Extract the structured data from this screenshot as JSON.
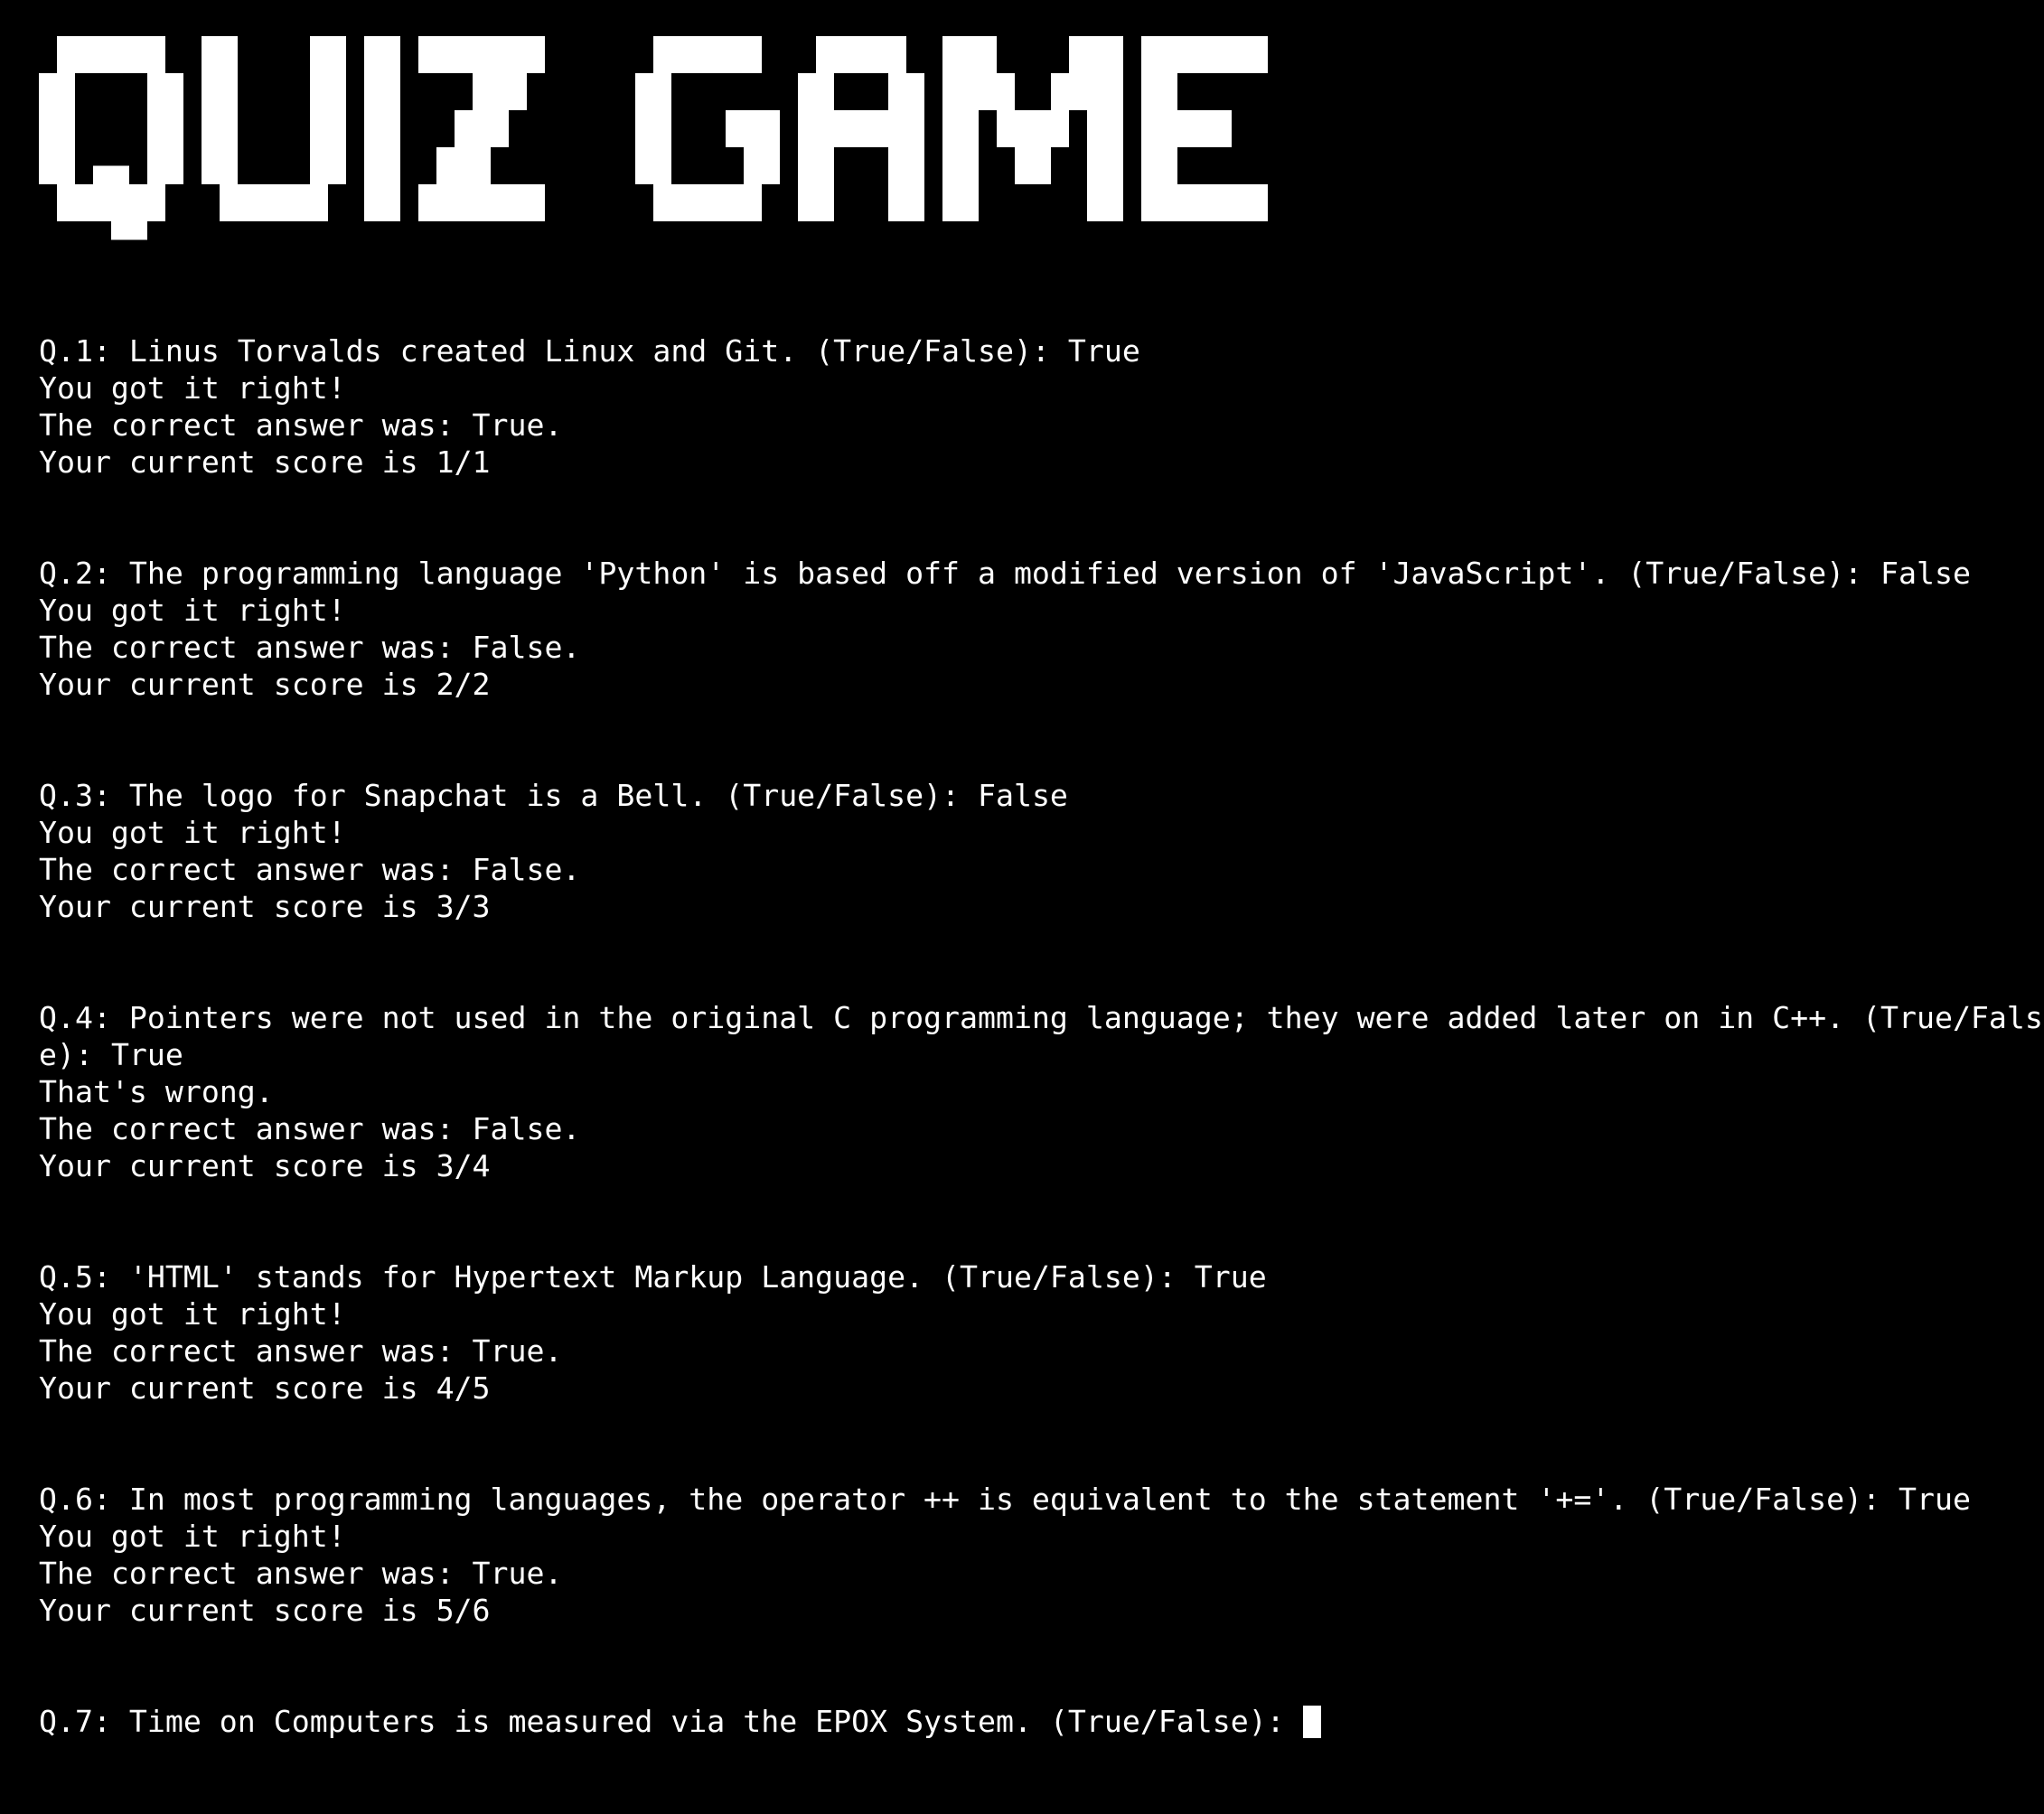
{
  "title": "QUIZ GAME",
  "colors": {
    "background": "#000000",
    "text": "#ffffff"
  },
  "questions": [
    {
      "prompt": "Q.1: Linus Torvalds created Linux and Git. (True/False): ",
      "user_answer": "True",
      "feedback": "You got it right!",
      "correct_line": "The correct answer was: True.",
      "score_line": "Your current score is 1/1"
    },
    {
      "prompt": "Q.2: The programming language 'Python' is based off a modified version of 'JavaScript'. (True/False): ",
      "user_answer": "False",
      "feedback": "You got it right!",
      "correct_line": "The correct answer was: False.",
      "score_line": "Your current score is 2/2"
    },
    {
      "prompt": "Q.3: The logo for Snapchat is a Bell. (True/False): ",
      "user_answer": "False",
      "feedback": "You got it right!",
      "correct_line": "The correct answer was: False.",
      "score_line": "Your current score is 3/3"
    },
    {
      "prompt": "Q.4: Pointers were not used in the original C programming language; they were added later on in C++. (True/False): ",
      "user_answer": "True",
      "feedback": "That's wrong.",
      "correct_line": "The correct answer was: False.",
      "score_line": "Your current score is 3/4"
    },
    {
      "prompt": "Q.5: 'HTML' stands for Hypertext Markup Language. (True/False): ",
      "user_answer": "True",
      "feedback": "You got it right!",
      "correct_line": "The correct answer was: True.",
      "score_line": "Your current score is 4/5"
    },
    {
      "prompt": "Q.6: In most programming languages, the operator ++ is equivalent to the statement '+='. (True/False): ",
      "user_answer": "True",
      "feedback": "You got it right!",
      "correct_line": "The correct answer was: True.",
      "score_line": "Your current score is 5/6"
    }
  ],
  "current_question": {
    "prompt": "Q.7: Time on Computers is measured via the EPOX System. (True/False): ",
    "input_value": ""
  }
}
